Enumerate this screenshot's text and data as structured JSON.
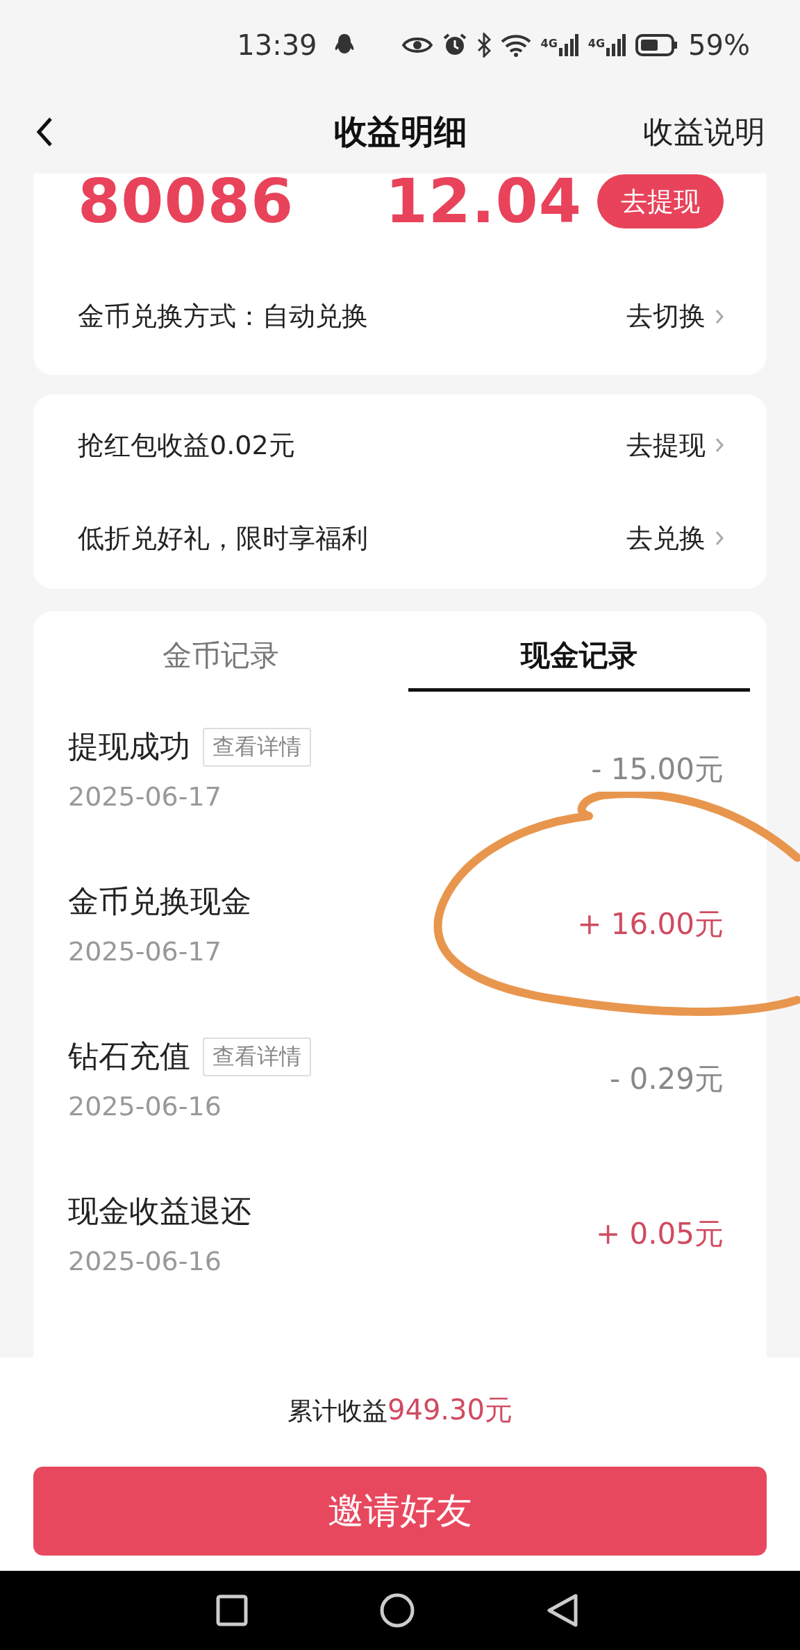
{
  "status_bar": {
    "time": "13:39",
    "networks": [
      "4G",
      "4G"
    ],
    "battery": "59%"
  },
  "nav": {
    "title": "收益明细",
    "action": "收益说明"
  },
  "summary": {
    "coins": "80086",
    "cash": "12.04",
    "withdraw_button": "去提现",
    "exchange_label": "金币兑换方式：自动兑换",
    "exchange_action": "去切换"
  },
  "links": [
    {
      "label": "抢红包收益0.02元",
      "action": "去提现"
    },
    {
      "label": "低折兑好礼，限时享福利",
      "action": "去兑换"
    }
  ],
  "tabs": [
    {
      "label": "金币记录",
      "selected": false
    },
    {
      "label": "现金记录",
      "selected": true
    }
  ],
  "records": [
    {
      "title": "提现成功",
      "detail_button": "查看详情",
      "date": "2025-06-17",
      "amount": "- 15.00元",
      "kind": "expense"
    },
    {
      "title": "金币兑换现金",
      "date": "2025-06-17",
      "amount": "+ 16.00元",
      "kind": "income"
    },
    {
      "title": "钻石充值",
      "detail_button": "查看详情",
      "date": "2025-06-16",
      "amount": "- 0.29元",
      "kind": "expense"
    },
    {
      "title": "现金收益退还",
      "date": "2025-06-16",
      "amount": "+ 0.05元",
      "kind": "income"
    }
  ],
  "footer": {
    "total_label": "累计收益",
    "total_value": "949.30元",
    "invite_button": "邀请好友"
  }
}
